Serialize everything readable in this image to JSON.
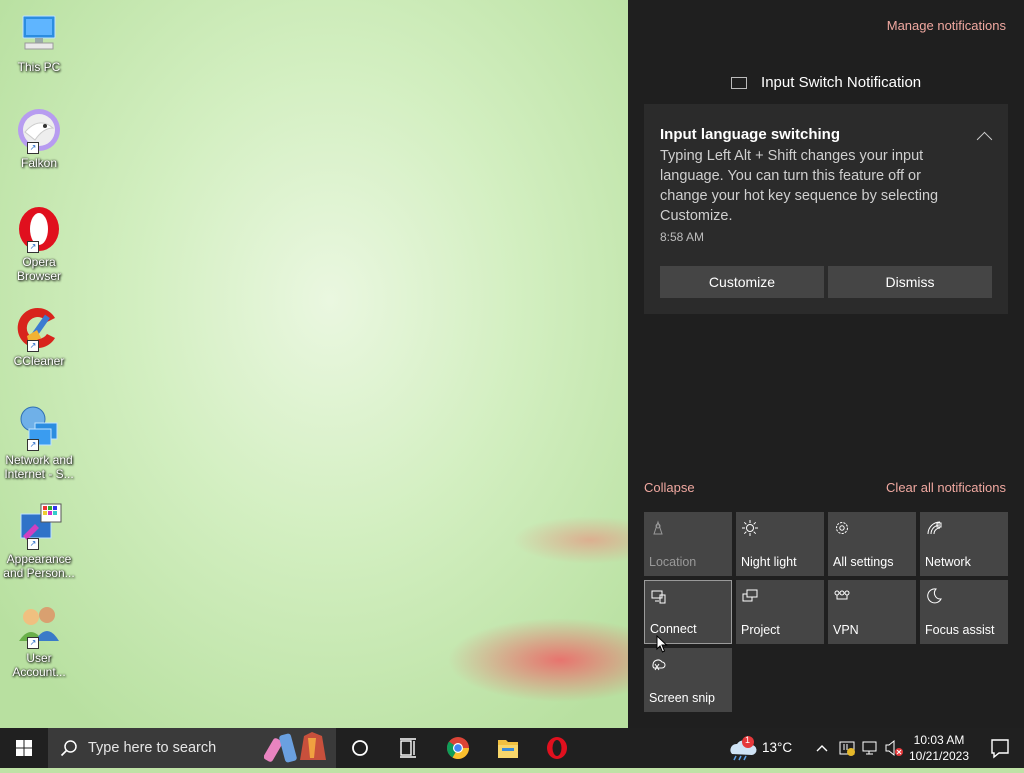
{
  "desktop": {
    "icons": [
      {
        "label": "This PC",
        "icon": "this-pc-icon"
      },
      {
        "label": "Falkon",
        "icon": "falkon-icon"
      },
      {
        "label": "Opera Browser",
        "icon": "opera-icon"
      },
      {
        "label": "CCleaner",
        "icon": "ccleaner-icon"
      },
      {
        "label": "Network and Internet - S...",
        "icon": "network-internet-icon"
      },
      {
        "label": "Appearance and Person...",
        "icon": "appearance-icon"
      },
      {
        "label": "User Account...",
        "icon": "user-accounts-icon"
      }
    ]
  },
  "action_center": {
    "manage_label": "Manage notifications",
    "group_title": "Input Switch Notification",
    "toast": {
      "title": "Input language switching",
      "body": "Typing Left Alt + Shift changes your input language. You can turn this feature off or change your hot key sequence by selecting Customize.",
      "time": "8:58 AM",
      "customize_label": "Customize",
      "dismiss_label": "Dismiss"
    },
    "collapse_label": "Collapse",
    "clear_all_label": "Clear all notifications",
    "quick_actions": [
      {
        "label": "Location",
        "icon": "location-icon",
        "state": "off"
      },
      {
        "label": "Night light",
        "icon": "brightness-icon",
        "state": "off"
      },
      {
        "label": "All settings",
        "icon": "gear-icon",
        "state": "off"
      },
      {
        "label": "Network",
        "icon": "wifi-icon",
        "state": "off"
      },
      {
        "label": "Connect",
        "icon": "connect-icon",
        "state": "hover"
      },
      {
        "label": "Project",
        "icon": "project-icon",
        "state": "off"
      },
      {
        "label": "VPN",
        "icon": "vpn-icon",
        "state": "off"
      },
      {
        "label": "Focus assist",
        "icon": "moon-icon",
        "state": "off"
      },
      {
        "label": "Screen snip",
        "icon": "screen-snip-icon",
        "state": "off"
      }
    ]
  },
  "taskbar": {
    "search_placeholder": "Type here to search",
    "weather": {
      "temp": "13°C",
      "badge": "1"
    },
    "clock": {
      "time": "10:03 AM",
      "date": "10/21/2023"
    }
  },
  "colors": {
    "action_center_bg": "#1f1f1f",
    "tile_bg": "#454545",
    "link_accent": "#f0a8a0",
    "taskbar_bg": "#202020"
  }
}
